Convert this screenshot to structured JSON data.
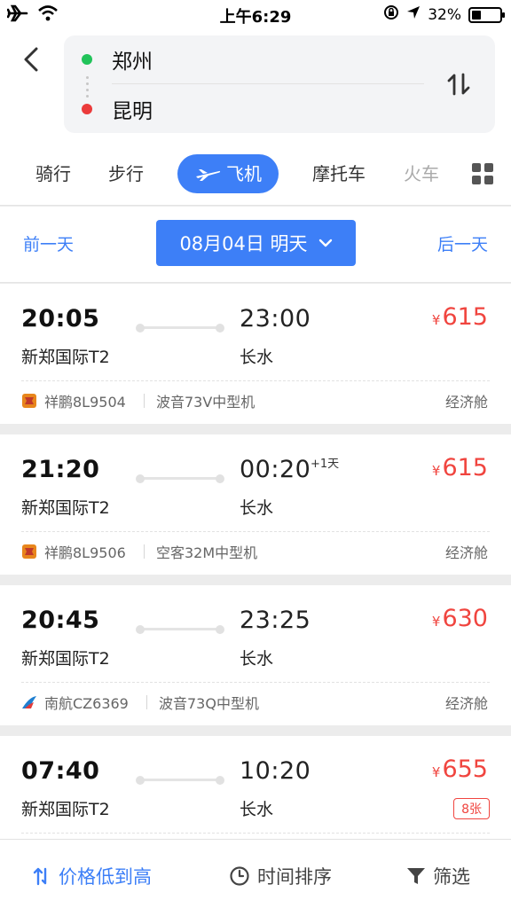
{
  "status_bar": {
    "time": "上午6:29",
    "battery_text": "32%",
    "battery_level": 0.32,
    "icons": [
      "airplane-mode-icon",
      "wifi-icon",
      "orientation-lock-icon",
      "location-arrow-icon",
      "battery-icon"
    ]
  },
  "route": {
    "from": "郑州",
    "to": "昆明",
    "colors": {
      "from_dot": "#21c35a",
      "to_dot": "#eb3b3b"
    }
  },
  "tabs": {
    "items": [
      "骑行",
      "步行",
      "飞机",
      "摩托车",
      "火车"
    ],
    "active": "飞机",
    "accent": "#3d7ff7"
  },
  "datebar": {
    "prev": "前一天",
    "date": "08月04日 明天",
    "next": "后一天"
  },
  "flights": [
    {
      "dep_time": "20:05",
      "dep_airport": "新郑国际T2",
      "arr_time": "23:00",
      "arr_airport": "长水",
      "plus_day": "",
      "price_symbol": "¥",
      "price": "615",
      "airline": "祥鹏8L9504",
      "aircraft": "波音73V中型机",
      "cabin": "经济舱",
      "badge": ""
    },
    {
      "dep_time": "21:20",
      "dep_airport": "新郑国际T2",
      "arr_time": "00:20",
      "arr_airport": "长水",
      "plus_day": "+1天",
      "price_symbol": "¥",
      "price": "615",
      "airline": "祥鹏8L9506",
      "aircraft": "空客32M中型机",
      "cabin": "经济舱",
      "badge": ""
    },
    {
      "dep_time": "20:45",
      "dep_airport": "新郑国际T2",
      "arr_time": "23:25",
      "arr_airport": "长水",
      "plus_day": "",
      "price_symbol": "¥",
      "price": "630",
      "airline": "南航CZ6369",
      "aircraft": "波音73Q中型机",
      "cabin": "经济舱",
      "badge": ""
    },
    {
      "dep_time": "07:40",
      "dep_airport": "新郑国际T2",
      "arr_time": "10:20",
      "arr_airport": "长水",
      "plus_day": "",
      "price_symbol": "¥",
      "price": "655",
      "airline": "",
      "aircraft": "",
      "cabin": "",
      "badge": "8张"
    }
  ],
  "bottom_bar": {
    "sort_price": "价格低到高",
    "sort_time": "时间排序",
    "filter": "筛选"
  }
}
